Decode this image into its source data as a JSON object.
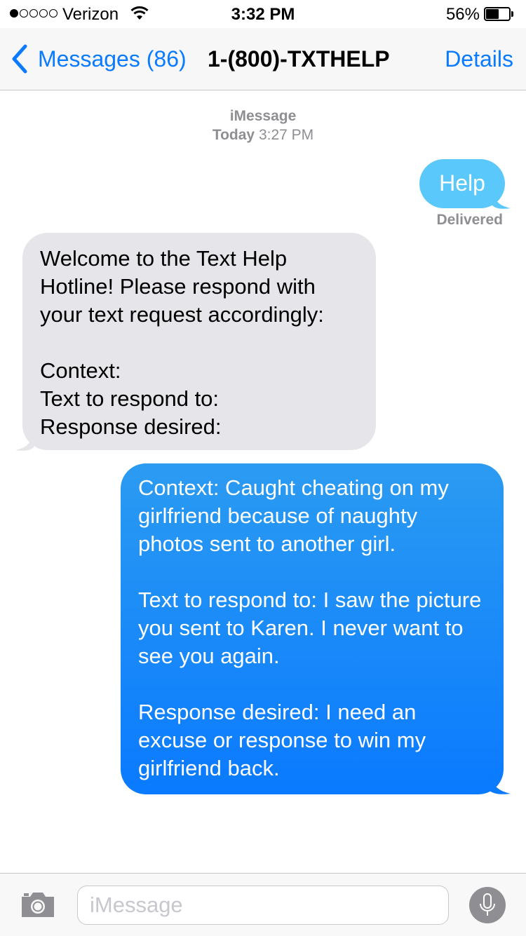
{
  "status_bar": {
    "signal_filled": 1,
    "signal_total": 5,
    "carrier": "Verizon",
    "time": "3:32 PM",
    "battery_percent_label": "56%",
    "battery_level": 0.56
  },
  "nav": {
    "back_label": "Messages (86)",
    "title": "1-(800)-TXTHELP",
    "details_label": "Details"
  },
  "conversation": {
    "service": "iMessage",
    "date_day": "Today",
    "date_time": "3:27 PM",
    "messages": [
      {
        "direction": "outgoing",
        "text": "Help",
        "status": "Delivered"
      },
      {
        "direction": "incoming",
        "text": "Welcome to the Text Help Hotline! Please respond with your text request accordingly:\n\nContext:\nText to respond to:\nResponse desired:"
      },
      {
        "direction": "outgoing",
        "text": "Context: Caught cheating on my girlfriend because of naughty photos sent to another girl.\n\nText to respond to: I saw the picture you sent to Karen. I never want to see you again.\n\nResponse desired: I need an excuse or response to win my girlfriend back."
      }
    ]
  },
  "input_bar": {
    "placeholder": "iMessage",
    "value": "",
    "camera_icon": "camera-icon",
    "mic_icon": "microphone-icon"
  },
  "colors": {
    "accent": "#0a7aff",
    "outgoing_bubble_light": "#5ac8fa",
    "outgoing_bubble": "#0a7aff",
    "incoming_bubble": "#e5e5ea",
    "meta_text": "#8e8e93"
  }
}
